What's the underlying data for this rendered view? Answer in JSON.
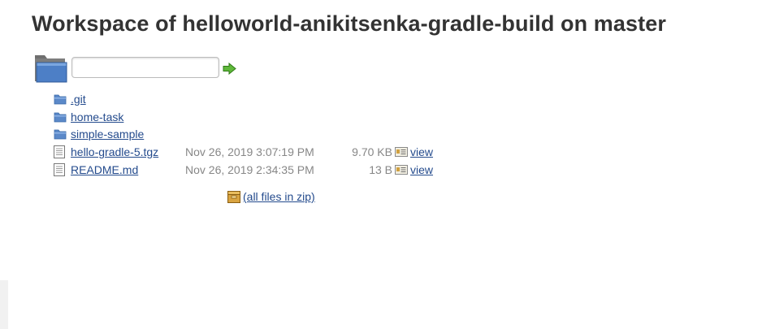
{
  "page": {
    "title": "Workspace of helloworld-anikitsenka-gradle-build on master"
  },
  "path_bar": {
    "input_value": "",
    "folder_icon": "folder-icon",
    "go_icon": "green-arrow-icon"
  },
  "files": [
    {
      "kind": "folder",
      "name": ".git"
    },
    {
      "kind": "folder",
      "name": "home-task"
    },
    {
      "kind": "folder",
      "name": "simple-sample"
    },
    {
      "kind": "file",
      "name": "hello-gradle-5.tgz",
      "date": "Nov 26, 2019 3:07:19 PM",
      "size": "9.70 KB",
      "view_label": "view"
    },
    {
      "kind": "file",
      "name": "README.md",
      "date": "Nov 26, 2019 2:34:35 PM",
      "size": "13 B",
      "view_label": "view"
    }
  ],
  "zip_link": {
    "label": "(all files in zip)",
    "icon": "archive-icon"
  },
  "colors": {
    "link": "#244b8d",
    "meta_text": "#878787",
    "heading": "#333333"
  }
}
